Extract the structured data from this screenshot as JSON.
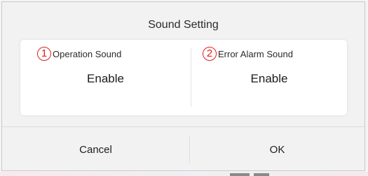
{
  "dialog": {
    "title": "Sound Setting",
    "options": [
      {
        "number": "1",
        "label": "Operation Sound",
        "value": "Enable"
      },
      {
        "number": "2",
        "label": "Error Alarm Sound",
        "value": "Enable"
      }
    ],
    "cancel_label": "Cancel",
    "ok_label": "OK"
  },
  "colors": {
    "number_badge": "#e02020",
    "card_background": "#ffffff",
    "dialog_background": "#f2f2f2"
  }
}
